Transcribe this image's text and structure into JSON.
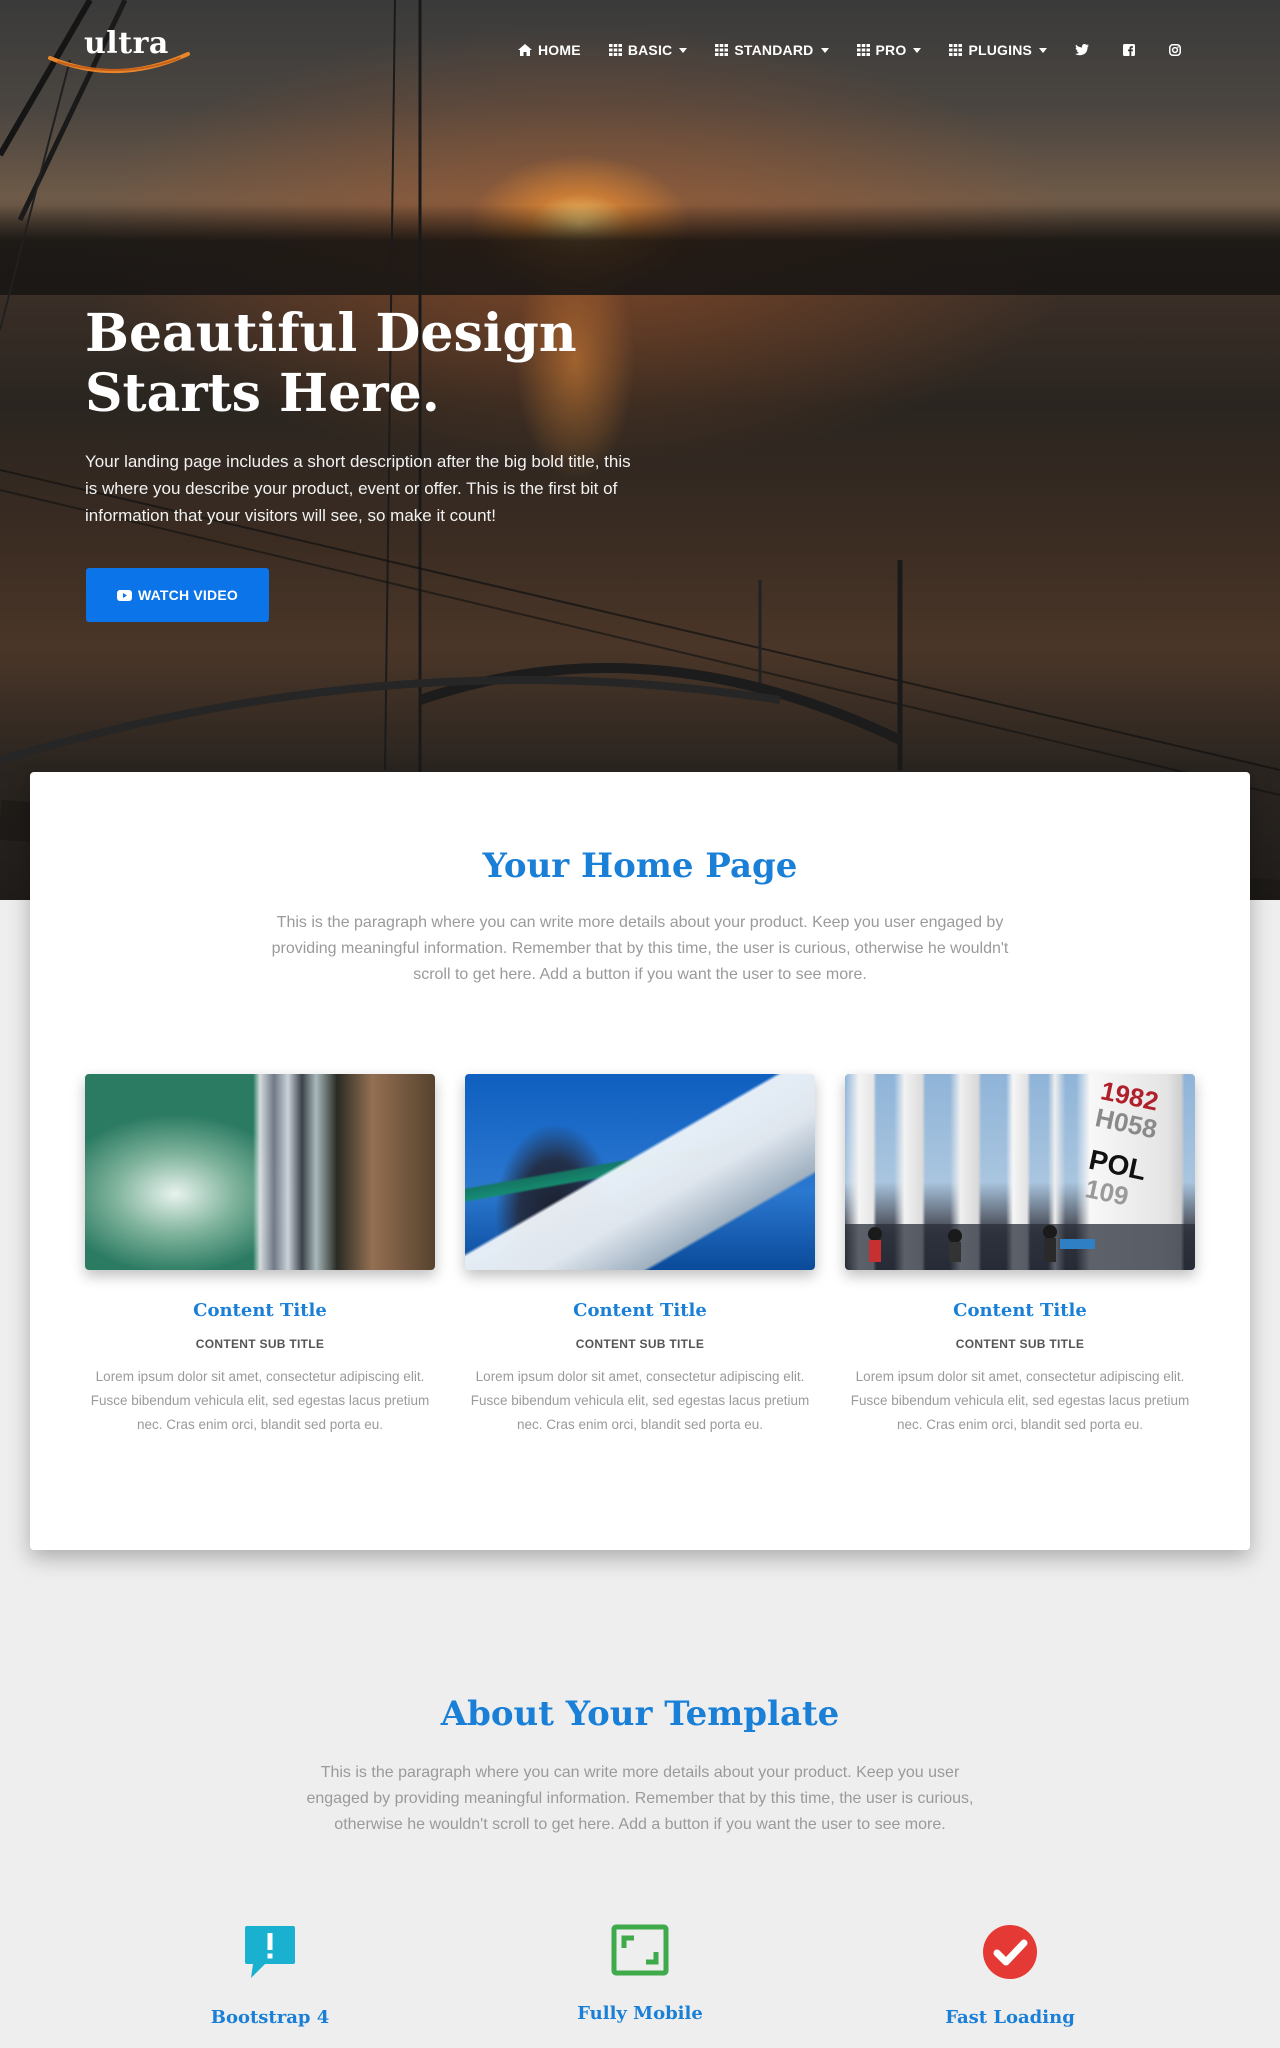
{
  "brand": {
    "logo_text": "ultra"
  },
  "nav": {
    "items": [
      {
        "label": "HOME",
        "icon": "home-icon",
        "dropdown": false
      },
      {
        "label": "BASIC",
        "icon": "grid-icon",
        "dropdown": true
      },
      {
        "label": "STANDARD",
        "icon": "grid-icon",
        "dropdown": true
      },
      {
        "label": "PRO",
        "icon": "grid-icon",
        "dropdown": true
      },
      {
        "label": "PLUGINS",
        "icon": "grid-icon",
        "dropdown": true
      }
    ],
    "social": [
      "twitter-icon",
      "facebook-icon",
      "instagram-icon"
    ]
  },
  "hero": {
    "title_line1": "Beautiful Design",
    "title_line2": "Starts Here.",
    "description": "Your landing page includes a short description after the big bold title, this is where you describe your product, event or offer. This is the first bit of information that your visitors will see, so make it count!",
    "button_label": "WATCH VIDEO",
    "button_icon": "youtube-icon"
  },
  "home_section": {
    "title": "Your Home Page",
    "paragraph": "This is the paragraph where you can write more details about your product. Keep you user engaged by providing meaningful information. Remember that by this time, the user is curious, otherwise he wouldn't scroll to get here. Add a button if you want the user to see more.",
    "features": [
      {
        "title": "Content Title",
        "subtitle": "CONTENT SUB TITLE",
        "text": "Lorem ipsum dolor sit amet, consectetur adipiscing elit. Fusce bibendum vehicula elit, sed egestas lacus pretium nec. Cras enim orci, blandit sed porta eu."
      },
      {
        "title": "Content Title",
        "subtitle": "CONTENT SUB TITLE",
        "text": "Lorem ipsum dolor sit amet, consectetur adipiscing elit. Fusce bibendum vehicula elit, sed egestas lacus pretium nec. Cras enim orci, blandit sed porta eu."
      },
      {
        "title": "Content Title",
        "subtitle": "CONTENT SUB TITLE",
        "text": "Lorem ipsum dolor sit amet, consectetur adipiscing elit. Fusce bibendum vehicula elit, sed egestas lacus pretium nec. Cras enim orci, blandit sed porta eu."
      }
    ],
    "regatta_sail_numbers": [
      "1982",
      "H058",
      "POL",
      "109"
    ]
  },
  "about_section": {
    "title": "About Your Template",
    "paragraph": "This is the paragraph where you can write more details about your product. Keep you user engaged by providing meaningful information. Remember that by this time, the user is curious, otherwise he wouldn't scroll to get here. Add a button if you want the user to see more.",
    "features": [
      {
        "title": "Bootstrap 4",
        "icon": "exclamation-comment-icon",
        "color": "#1ab0d0"
      },
      {
        "title": "Fully Mobile",
        "icon": "expand-square-icon",
        "color": "#3faa4a"
      },
      {
        "title": "Fast Loading",
        "icon": "check-circle-icon",
        "color": "#e53935"
      }
    ]
  },
  "colors": {
    "accent": "#1a7fd6",
    "button": "#0a74e8",
    "background": "#eeeeee"
  }
}
